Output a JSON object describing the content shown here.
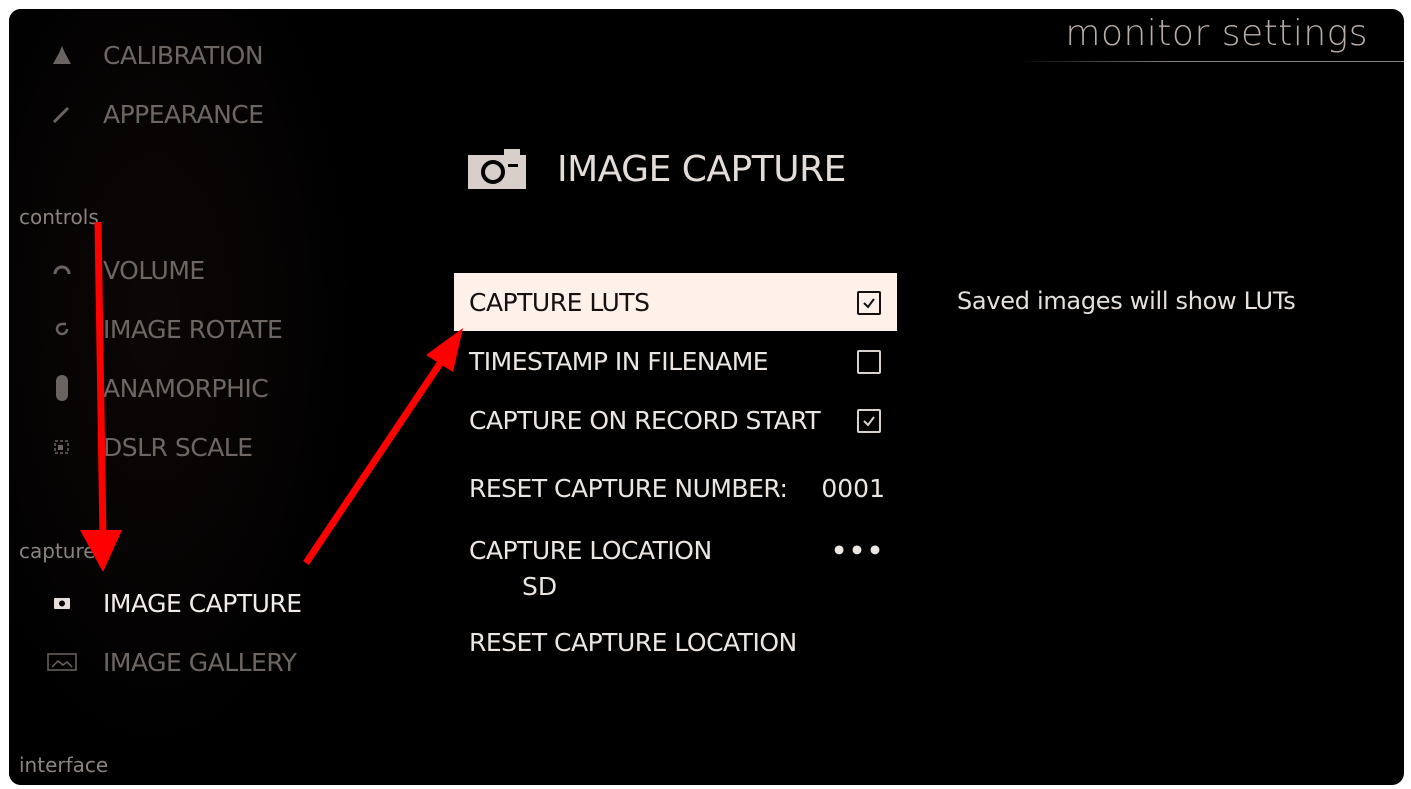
{
  "app": {
    "title": "monitor settings"
  },
  "sections": {
    "controls": "controls",
    "capture": "capture",
    "interface": "interface"
  },
  "nav": {
    "calibration": "CALIBRATION",
    "appearance": "APPEARANCE",
    "volume": "VOLUME",
    "image_rotate": "IMAGE ROTATE",
    "anamorphic": "ANAMORPHIC",
    "dslr_scale": "DSLR SCALE",
    "image_capture": "IMAGE CAPTURE",
    "image_gallery": "IMAGE GALLERY"
  },
  "panel": {
    "title": "IMAGE CAPTURE",
    "rows": {
      "capture_luts": {
        "label": "CAPTURE LUTS",
        "checked": true
      },
      "timestamp": {
        "label": "TIMESTAMP IN FILENAME",
        "checked": false
      },
      "record_start": {
        "label": "CAPTURE ON RECORD START",
        "checked": true
      },
      "reset_number": {
        "label": "RESET CAPTURE NUMBER:",
        "value": "0001"
      },
      "location": {
        "label": "CAPTURE LOCATION",
        "value": "•••",
        "sub": "SD"
      },
      "reset_location": {
        "label": "RESET CAPTURE LOCATION"
      }
    },
    "help": "Saved images will show LUTs"
  },
  "colors": {
    "accent": "#fdf1ea",
    "annotation": "#ff0000",
    "background": "#000000"
  }
}
